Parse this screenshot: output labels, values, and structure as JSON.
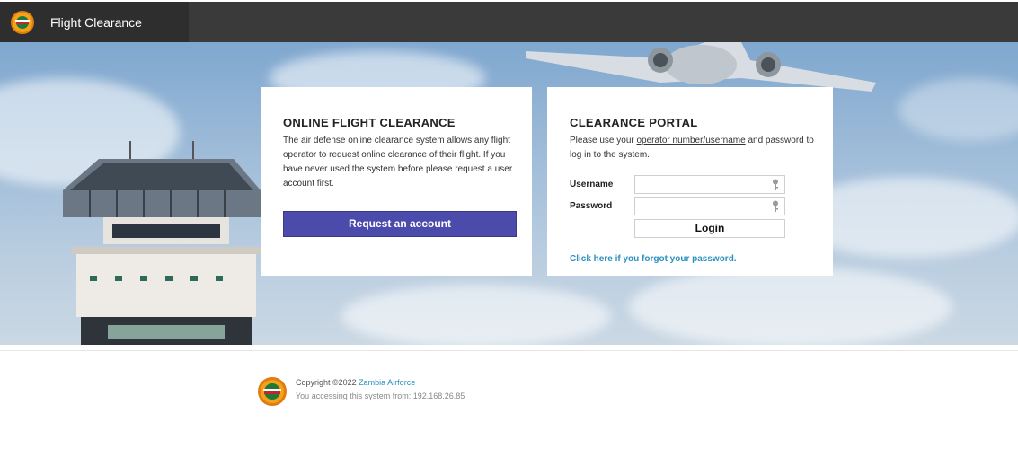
{
  "header": {
    "title": "Flight Clearance",
    "logo_icon": "airforce-roundel-logo"
  },
  "info_card": {
    "heading": "ONLINE FLIGHT CLEARANCE",
    "body": "The air defense online clearance system allows any flight operator to request online clearance of their flight. If you have never used the system before please request a user account first.",
    "button_label": "Request an account"
  },
  "portal_card": {
    "heading": "CLEARANCE PORTAL",
    "intro_before": "Please use your ",
    "intro_link": "operator number/username",
    "intro_after": " and password to log in to the system.",
    "username_label": "Username",
    "username_value": "",
    "password_label": "Password",
    "password_value": "",
    "login_label": "Login",
    "forgot_link": "Click here if you forgot your password."
  },
  "footer": {
    "copyright_prefix": "Copyright ©2022 ",
    "copyright_org": "Zambia Airforce",
    "access_text": "You accessing this system from: 192.168.26.85"
  },
  "colors": {
    "navbar": "#3a3a3a",
    "brand_bg": "#2e2e2e",
    "request_button": "#4b4bab",
    "link": "#2a8fbf"
  }
}
